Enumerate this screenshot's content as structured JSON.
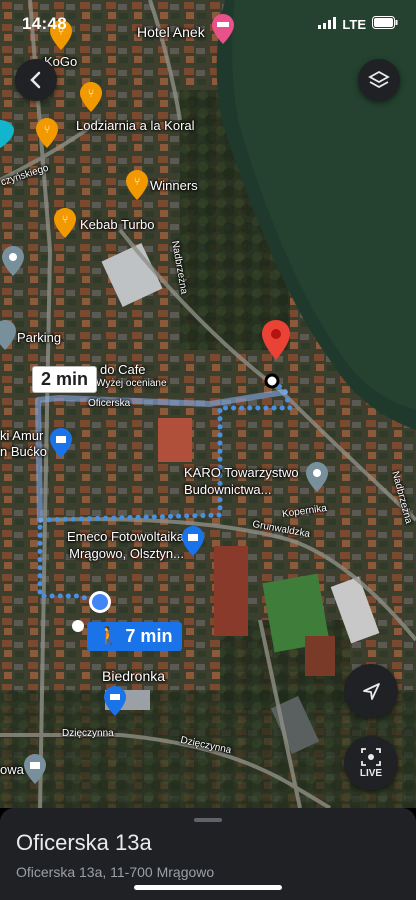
{
  "status_bar": {
    "time": "14:48",
    "network": "LTE"
  },
  "map": {
    "places": [
      {
        "id": "hotel",
        "name": "Hotel Anek",
        "icon": "hotel-icon"
      },
      {
        "id": "kogo",
        "name": "KoGo",
        "icon": "restaurant-icon"
      },
      {
        "id": "lodziarnia",
        "name": "Lodziarnia a la Koral",
        "icon": "restaurant-icon"
      },
      {
        "id": "winners",
        "name": "Winners",
        "icon": "restaurant-icon"
      },
      {
        "id": "kebab",
        "name": "Kebab Turbo",
        "icon": "restaurant-icon"
      },
      {
        "id": "parking",
        "name": "Parking",
        "icon": "parking-icon"
      },
      {
        "id": "cafe",
        "name": "do Cafe",
        "icon": "cafe-icon"
      },
      {
        "id": "cafe_sub",
        "name": "Wyżej oceniane",
        "icon": ""
      },
      {
        "id": "amur",
        "name": "ki Amur",
        "icon": "shopping-icon"
      },
      {
        "id": "bucko",
        "name": "n Bućko",
        "icon": ""
      },
      {
        "id": "karo",
        "name": "KARO Towarzystwo Budownictwa...",
        "icon": "pin-icon"
      },
      {
        "id": "emeco",
        "name": "Emeco Fotowoltaika Mrągowo, Olsztyn...",
        "icon": "shopping-icon"
      },
      {
        "id": "biedronka",
        "name": "Biedronka",
        "icon": "cart-icon"
      },
      {
        "id": "owa",
        "name": "owa",
        "icon": "museum-icon"
      }
    ],
    "streets": [
      "Oficerska",
      "Kopernika",
      "Grunwaldzka",
      "Dzięczynna",
      "Dzięczynna",
      "Nadbrzeżna",
      "Nadbrzeżna",
      "czyńskiego"
    ],
    "route": {
      "alt_time": "2 min",
      "main_time": "7 min",
      "mode": "walking"
    }
  },
  "buttons": {
    "back": "back",
    "layers": "layers",
    "navigate": "navigate",
    "live": "LIVE"
  },
  "sheet": {
    "title": "Oficerska 13a",
    "address": "Oficerska 13a, 11-700 Mrągowo"
  }
}
